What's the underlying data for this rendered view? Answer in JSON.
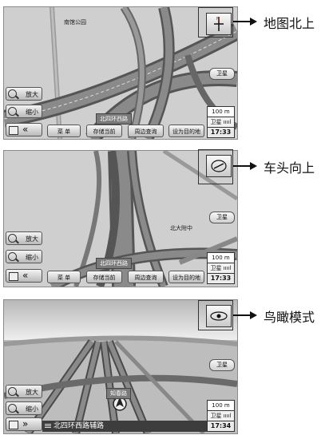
{
  "panels": [
    {
      "poi": "南馆公园",
      "road_label": "北四环西路",
      "zoom_in": "放大",
      "zoom_out": "缩小",
      "collapse": "«",
      "buttons": [
        "菜 单",
        "存储当前",
        "周边查询",
        "设为目的地"
      ],
      "gps": "卫星",
      "scale": "100 m",
      "signal": "卫星 ııııl",
      "clock": "17:33",
      "callout": "地图北上"
    },
    {
      "poi": "北大附中",
      "road_label": "北四环西路",
      "zoom_in": "放大",
      "zoom_out": "缩小",
      "collapse": "«",
      "buttons": [
        "菜 单",
        "存储当前",
        "周边查询",
        "设为目的地"
      ],
      "gps": "卫星",
      "scale": "100 m",
      "signal": "卫星 ııııl",
      "clock": "17:33",
      "callout": "车头向上"
    },
    {
      "road_label": "知春路",
      "zoom_in": "放大",
      "zoom_out": "缩小",
      "expand": "»",
      "street": "北四环西路辅路",
      "gps": "卫星",
      "scale": "100 m",
      "signal": "卫星 ııııl",
      "clock": "17:34",
      "callout": "鸟瞰模式"
    }
  ]
}
